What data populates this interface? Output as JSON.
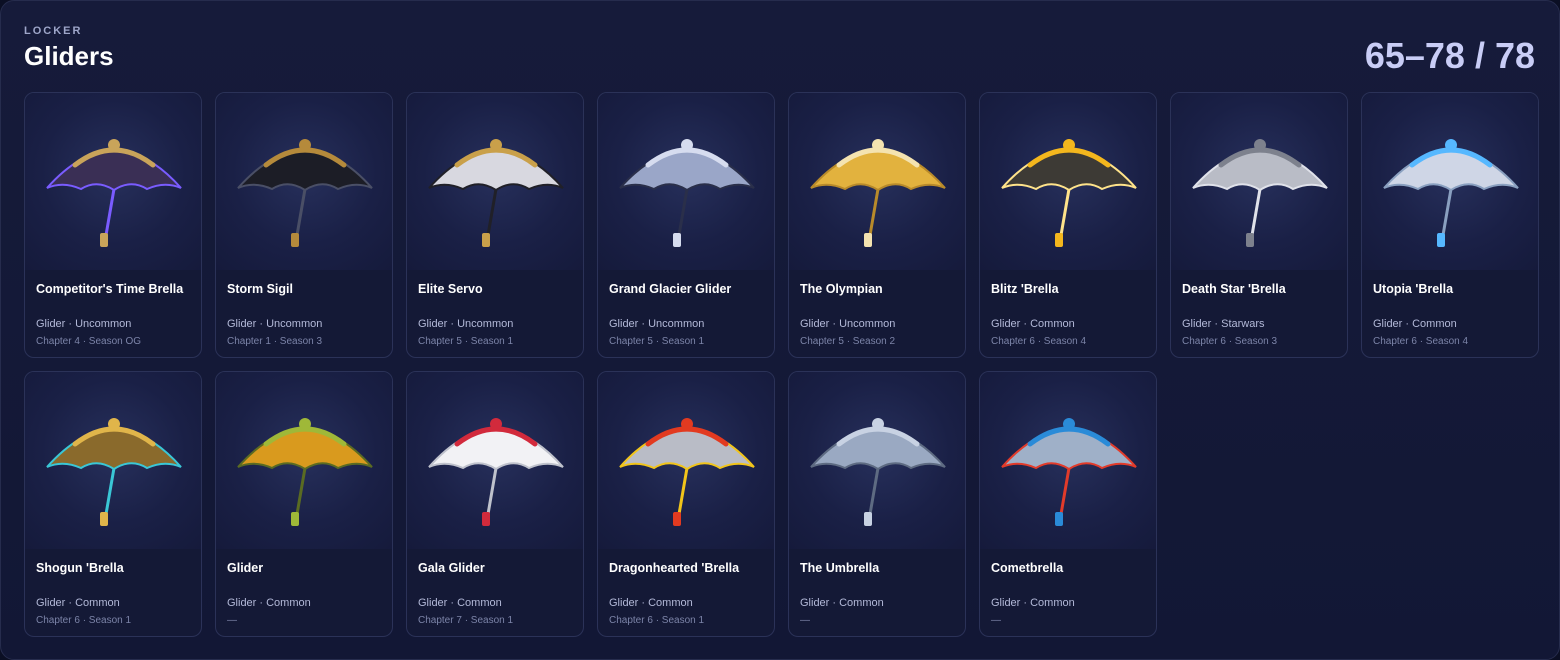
{
  "header": {
    "kicker": "LOCKER",
    "title": "Gliders",
    "count": "65–78 / 78"
  },
  "colors": {
    "background": "#121735",
    "card": "#141936",
    "count_text": "#c9cdf6"
  },
  "items": [
    {
      "name": "Competitor's Time Brella",
      "type": "Glider · Uncommon",
      "season": "Chapter 4 · Season OG",
      "icon": "competitors-time-brella-icon",
      "colors": [
        "#3a2f55",
        "#c9a45a",
        "#7a5cff"
      ]
    },
    {
      "name": "Storm Sigil",
      "type": "Glider · Uncommon",
      "season": "Chapter 1 · Season 3",
      "icon": "storm-sigil-icon",
      "colors": [
        "#1c1d26",
        "#b58a3b",
        "#4a4f66"
      ]
    },
    {
      "name": "Elite Servo",
      "type": "Glider · Uncommon",
      "season": "Chapter 5 · Season 1",
      "icon": "elite-servo-icon",
      "colors": [
        "#d8d8e0",
        "#c9a04a",
        "#202028"
      ]
    },
    {
      "name": "Grand Glacier Glider",
      "type": "Glider · Uncommon",
      "season": "Chapter 5 · Season 1",
      "icon": "grand-glacier-glider-icon",
      "colors": [
        "#9aa6c8",
        "#d6dcef",
        "#2a2f4a"
      ]
    },
    {
      "name": "The Olympian",
      "type": "Glider · Uncommon",
      "season": "Chapter 5 · Season 2",
      "icon": "the-olympian-icon",
      "colors": [
        "#e2b23e",
        "#f4e3b0",
        "#b88a2a"
      ]
    },
    {
      "name": "Blitz 'Brella",
      "type": "Glider · Common",
      "season": "Chapter 6 · Season 4",
      "icon": "blitz-brella-icon",
      "colors": [
        "#3d3a35",
        "#f4b71d",
        "#ffe38a"
      ]
    },
    {
      "name": "Death Star 'Brella",
      "type": "Glider · Starwars",
      "season": "Chapter 6 · Season 3",
      "icon": "death-star-brella-icon",
      "colors": [
        "#b9bcc6",
        "#7d818d",
        "#e0e2ea"
      ]
    },
    {
      "name": "Utopia 'Brella",
      "type": "Glider · Common",
      "season": "Chapter 6 · Season 4",
      "icon": "utopia-brella-icon",
      "colors": [
        "#cfd6e6",
        "#56b8ff",
        "#8aa0c0"
      ]
    },
    {
      "name": "Shogun 'Brella",
      "type": "Glider · Common",
      "season": "Chapter 6 · Season 1",
      "icon": "shogun-brella-icon",
      "colors": [
        "#8a6a2c",
        "#e0b54a",
        "#3ac7d6"
      ]
    },
    {
      "name": "Glider",
      "type": "Glider · Common",
      "season": "—",
      "icon": "glider-icon",
      "colors": [
        "#d99a1e",
        "#9fb838",
        "#5a6b22"
      ]
    },
    {
      "name": "Gala Glider",
      "type": "Glider · Common",
      "season": "Chapter 7 · Season 1",
      "icon": "gala-glider-icon",
      "colors": [
        "#f2f2f5",
        "#d22a3c",
        "#bfc2cc"
      ]
    },
    {
      "name": "Dragonhearted 'Brella",
      "type": "Glider · Common",
      "season": "Chapter 6 · Season 1",
      "icon": "dragonhearted-brella-icon",
      "colors": [
        "#b9bcc6",
        "#e23a20",
        "#f2c51a"
      ]
    },
    {
      "name": "The Umbrella",
      "type": "Glider · Common",
      "season": "—",
      "icon": "the-umbrella-icon",
      "colors": [
        "#9aa9c2",
        "#c8d2e3",
        "#5e6b82"
      ]
    },
    {
      "name": "Cometbrella",
      "type": "Glider · Common",
      "season": "—",
      "icon": "cometbrella-icon",
      "colors": [
        "#9fb0c8",
        "#2a8bd8",
        "#e23b2a"
      ]
    }
  ]
}
